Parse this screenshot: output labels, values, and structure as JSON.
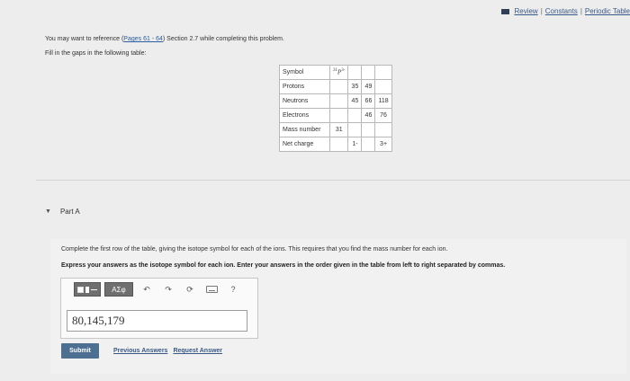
{
  "top_links": {
    "review": "Review",
    "separator": "|",
    "constants": "Constants",
    "periodic_table": "Periodic Table"
  },
  "intro": {
    "prefix": "You may want to reference (",
    "pages_link": "Pages 61 - 64",
    "suffix": ") Section 2.7 while completing this problem."
  },
  "instruction": "Fill in the gaps in the following table:",
  "table": {
    "rows": [
      {
        "label": "Symbol",
        "cells": [
          "",
          "",
          "",
          ""
        ]
      },
      {
        "label": "Protons",
        "cells": [
          "",
          "35",
          "49",
          ""
        ]
      },
      {
        "label": "Neutrons",
        "cells": [
          "",
          "45",
          "66",
          "118"
        ]
      },
      {
        "label": "Electrons",
        "cells": [
          "",
          "",
          "46",
          "76"
        ]
      },
      {
        "label": "Mass number",
        "cells": [
          "31",
          "",
          "",
          ""
        ]
      },
      {
        "label": "Net charge",
        "cells": [
          "",
          "1-",
          "",
          "3+"
        ]
      }
    ],
    "isotope": {
      "mass": "31",
      "symbol": "P",
      "charge": "3-"
    }
  },
  "part_a": {
    "label": "Part A",
    "question": "Complete the first row of the table, giving the isotope symbol for each of the ions. This requires that you find the mass number for each ion.",
    "instruction": "Express your answers as the isotope symbol for each ion. Enter your answers in the order given in the table from left to right separated by commas."
  },
  "toolbar": {
    "greek": "ΑΣφ",
    "help": "?",
    "icons": [
      "templates-icon",
      "greek-letters-button",
      "undo-icon",
      "redo-icon",
      "reset-icon",
      "keyboard-icon",
      "help-icon"
    ]
  },
  "answer": {
    "value": "80,145,179"
  },
  "actions": {
    "submit": "Submit",
    "previous_answers": "Previous Answers",
    "request_answer": "Request Answer"
  },
  "colors": {
    "submit_bg": "#4c6f92",
    "link": "#3a5a86",
    "page_bg": "#ededed"
  }
}
